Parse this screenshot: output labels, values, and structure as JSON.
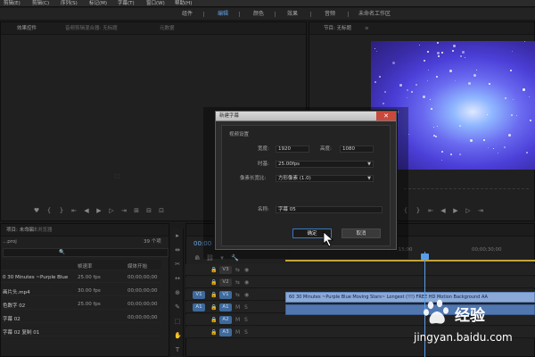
{
  "app": {
    "menus": [
      "剪辑(E)",
      "剪辑(C)",
      "序列(S)",
      "标记(M)",
      "字幕(T)",
      "窗口(W)",
      "帮助(H)"
    ]
  },
  "workspaces": {
    "tabs": [
      "组件",
      "编辑",
      "颜色",
      "效果",
      "音频",
      "未命名工作区"
    ],
    "active_index": 1
  },
  "source_monitor": {
    "tabs": [
      "效果控件",
      "音频剪辑混合器: 无标题",
      "元数据"
    ],
    "controls": [
      "♥",
      "{",
      "}",
      "⇤",
      "◀",
      "▶",
      "▷",
      "⇥",
      "⊞",
      "⊟",
      "⊡"
    ]
  },
  "program_monitor": {
    "tabs": [
      "节目: 无标题"
    ],
    "controls": [
      "{",
      "}",
      "⇤",
      "◀",
      "▶",
      "▷",
      "⇥"
    ]
  },
  "project_panel": {
    "tabs": [
      "项目: 未命名",
      "媒体浏览器"
    ],
    "file_name": "...proj",
    "item_count": "39 个项",
    "search_hint": "🔍",
    "columns": [
      "",
      "帧速率",
      "媒体开始"
    ],
    "rows": [
      {
        "name": "0 30 Minutes ~Purple Blue",
        "fps": "25.00 fps",
        "start": "00;00;00;00"
      },
      {
        "name": "画片头.mp4",
        "fps": "30.00 fps",
        "start": "00;00;00;00"
      },
      {
        "name": "色数字 02",
        "fps": "25.00 fps",
        "start": "00;00;00;00"
      },
      {
        "name": "字幕 02",
        "fps": "",
        "start": "00;00;00;00"
      },
      {
        "name": "字幕 02 复制 01",
        "fps": "",
        "start": ""
      }
    ]
  },
  "tools": [
    "▸",
    "⇹",
    "✂",
    "↔",
    "⊕",
    "✎",
    "⬚",
    "✋",
    "T"
  ],
  "timeline": {
    "timecode": "00:00",
    "ruler_marks": [
      "00;00",
      "00;00;15;00",
      "00;00;30;00"
    ],
    "tracks": [
      {
        "target": "",
        "label": "V3",
        "kind": "video"
      },
      {
        "target": "",
        "label": "V2",
        "kind": "video"
      },
      {
        "target": "V1",
        "label": "V1",
        "kind": "video"
      },
      {
        "target": "A1",
        "label": "A1",
        "kind": "audio"
      },
      {
        "target": "",
        "label": "A2",
        "kind": "audio"
      },
      {
        "target": "",
        "label": "A3",
        "kind": "audio"
      }
    ],
    "video_clip": "60 30 Minutes ~Purple Blue Moving Stars~ Longest (!!!) FREE HD Motion Background AA",
    "audio_clip": ""
  },
  "dialog": {
    "title": "新建字幕",
    "close_symbol": "✕",
    "section_title": "视频设置",
    "width_label": "宽度:",
    "width_value": "1920",
    "height_label": "高度:",
    "height_value": "1080",
    "timebase_label": "时基:",
    "timebase_value": "25.00fps",
    "par_label": "像素长宽比:",
    "par_value": "方形像素 (1.0)",
    "name_label": "名称:",
    "name_value": "字幕 05",
    "ok_label": "确定",
    "cancel_label": "取消"
  },
  "watermark": {
    "brand_cn": "经验",
    "url": "jingyan.baidu.com"
  }
}
